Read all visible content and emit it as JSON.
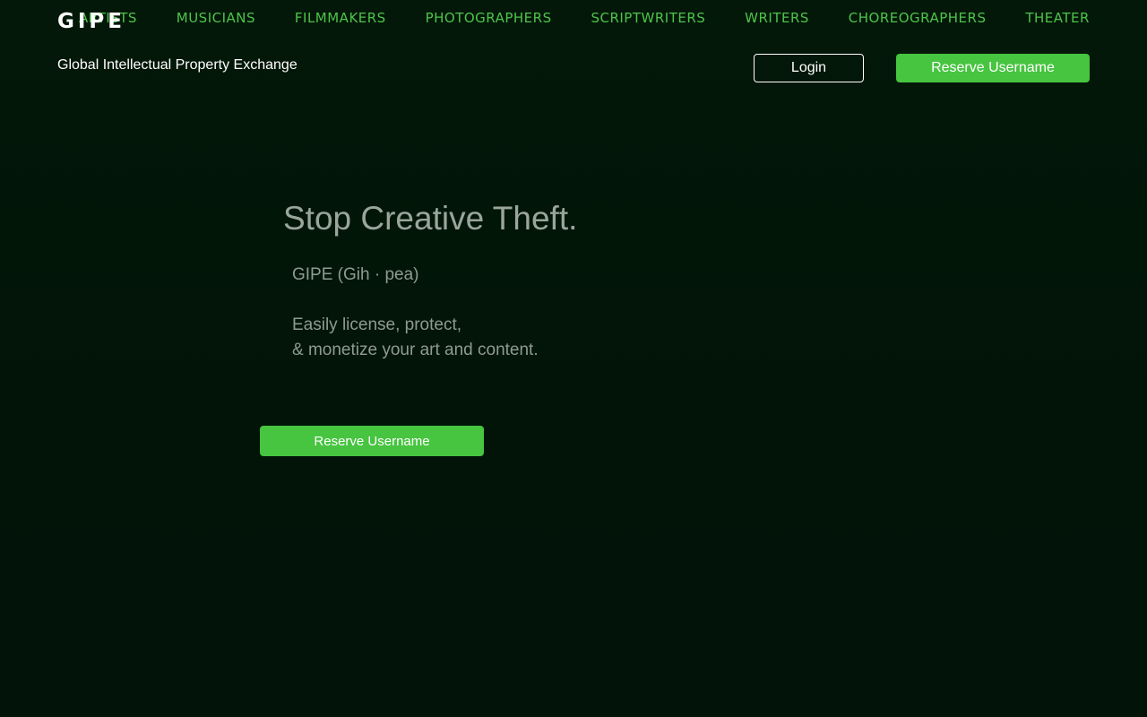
{
  "brand": {
    "logo": "GIPE",
    "tagline": "Global Intellectual Property Exchange"
  },
  "nav": {
    "items": [
      {
        "label": "Artists"
      },
      {
        "label": "Musicians"
      },
      {
        "label": "Filmmakers"
      },
      {
        "label": "Photographers"
      },
      {
        "label": "Scriptwriters"
      },
      {
        "label": "Writers"
      },
      {
        "label": "Choreographers"
      },
      {
        "label": "Theater"
      }
    ]
  },
  "header": {
    "login_label": "Login",
    "reserve_label": "Reserve Username"
  },
  "hero": {
    "title": "Stop Creative Theft.",
    "pronunciation": "GIPE (Gih · pea)",
    "desc_line1": "Easily license, protect,",
    "desc_line2": "& monetize your art and content.",
    "cta_label": "Reserve Username"
  },
  "colors": {
    "background": "#021408",
    "accent": "#47c440",
    "nav_text": "#4ec44a",
    "hero_text": "#9aa69a"
  }
}
